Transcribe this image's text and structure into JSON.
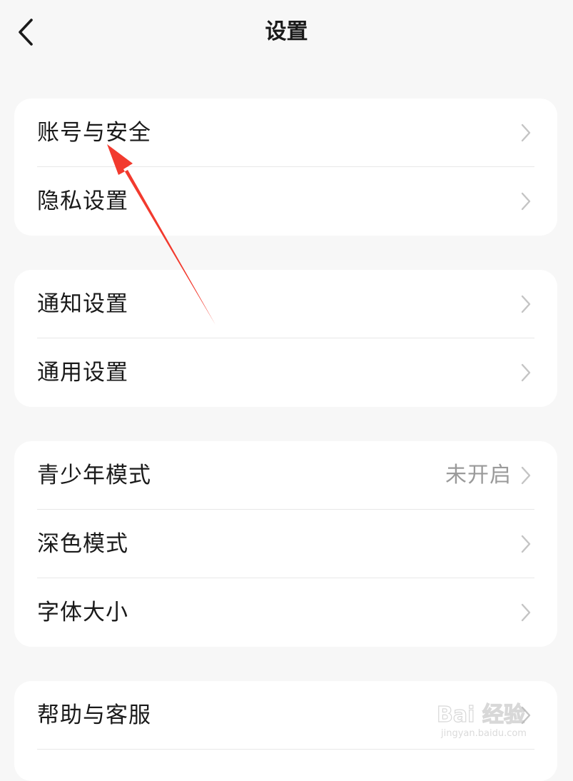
{
  "header": {
    "title": "设置",
    "back_icon": "chevron-left-icon"
  },
  "groups": [
    {
      "items": [
        {
          "label": "账号与安全",
          "value": ""
        },
        {
          "label": "隐私设置",
          "value": ""
        }
      ]
    },
    {
      "items": [
        {
          "label": "通知设置",
          "value": ""
        },
        {
          "label": "通用设置",
          "value": ""
        }
      ]
    },
    {
      "items": [
        {
          "label": "青少年模式",
          "value": "未开启"
        },
        {
          "label": "深色模式",
          "value": ""
        },
        {
          "label": "字体大小",
          "value": ""
        }
      ]
    },
    {
      "items": [
        {
          "label": "帮助与客服",
          "value": ""
        }
      ]
    }
  ],
  "annotation": {
    "color": "#f23a2e",
    "target": "账号与安全"
  },
  "watermark": {
    "main": "Bai  经验",
    "sub": "jingyan.baidu.com"
  },
  "colors": {
    "background": "#f7f7f7",
    "card": "#ffffff",
    "text": "#1a1a1a",
    "secondary_text": "#9a9a9a",
    "chevron": "#c4c4c4"
  }
}
